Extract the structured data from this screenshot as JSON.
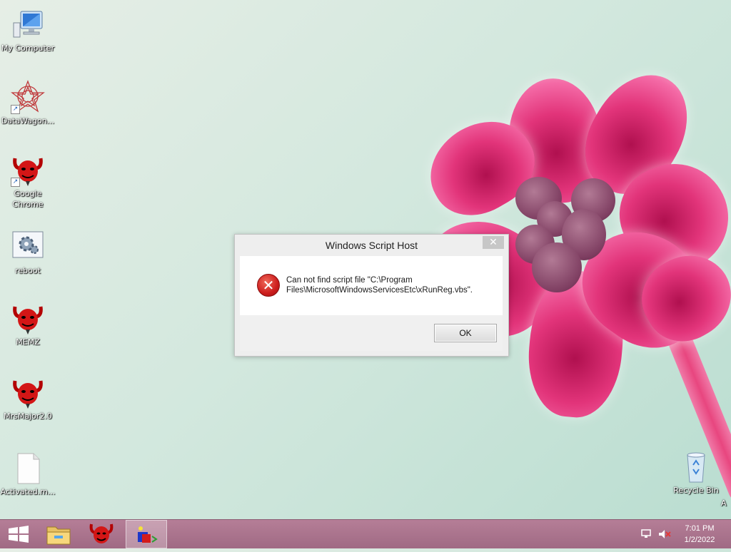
{
  "desktop": {
    "icons": [
      {
        "label": "My Computer",
        "icon": "computer-icon"
      },
      {
        "label": "DataWagon...",
        "icon": "datawagon-icon"
      },
      {
        "label": "Google Chrome",
        "icon": "devil-icon"
      },
      {
        "label": "reboot",
        "icon": "gear-icon"
      },
      {
        "label": "MEMZ",
        "icon": "devil-icon"
      },
      {
        "label": "MrsMajor2.0",
        "icon": "devil-icon"
      },
      {
        "label": "Activated.m...",
        "icon": "document-icon"
      },
      {
        "label": "Recycle Bin",
        "icon": "recycle-bin-icon"
      }
    ],
    "edge_char": "A"
  },
  "dialog": {
    "title": "Windows Script Host",
    "close_symbol": "✕",
    "message_line1": "Can not find script file \"C:\\Program",
    "message_line2": "Files\\MicrosoftWindowsServicesEtc\\xRunReg.vbs\".",
    "ok_label": "OK",
    "icon": "error-icon"
  },
  "taskbar": {
    "items": [
      "start-icon",
      "file-explorer-icon",
      "devil-icon",
      "script-host-icon"
    ],
    "clock_time": "7:01 PM",
    "clock_date": "1/2/2022"
  },
  "colors": {
    "taskbar": "#a97189",
    "petal": "#e2347a",
    "error": "#cc1d1d"
  }
}
